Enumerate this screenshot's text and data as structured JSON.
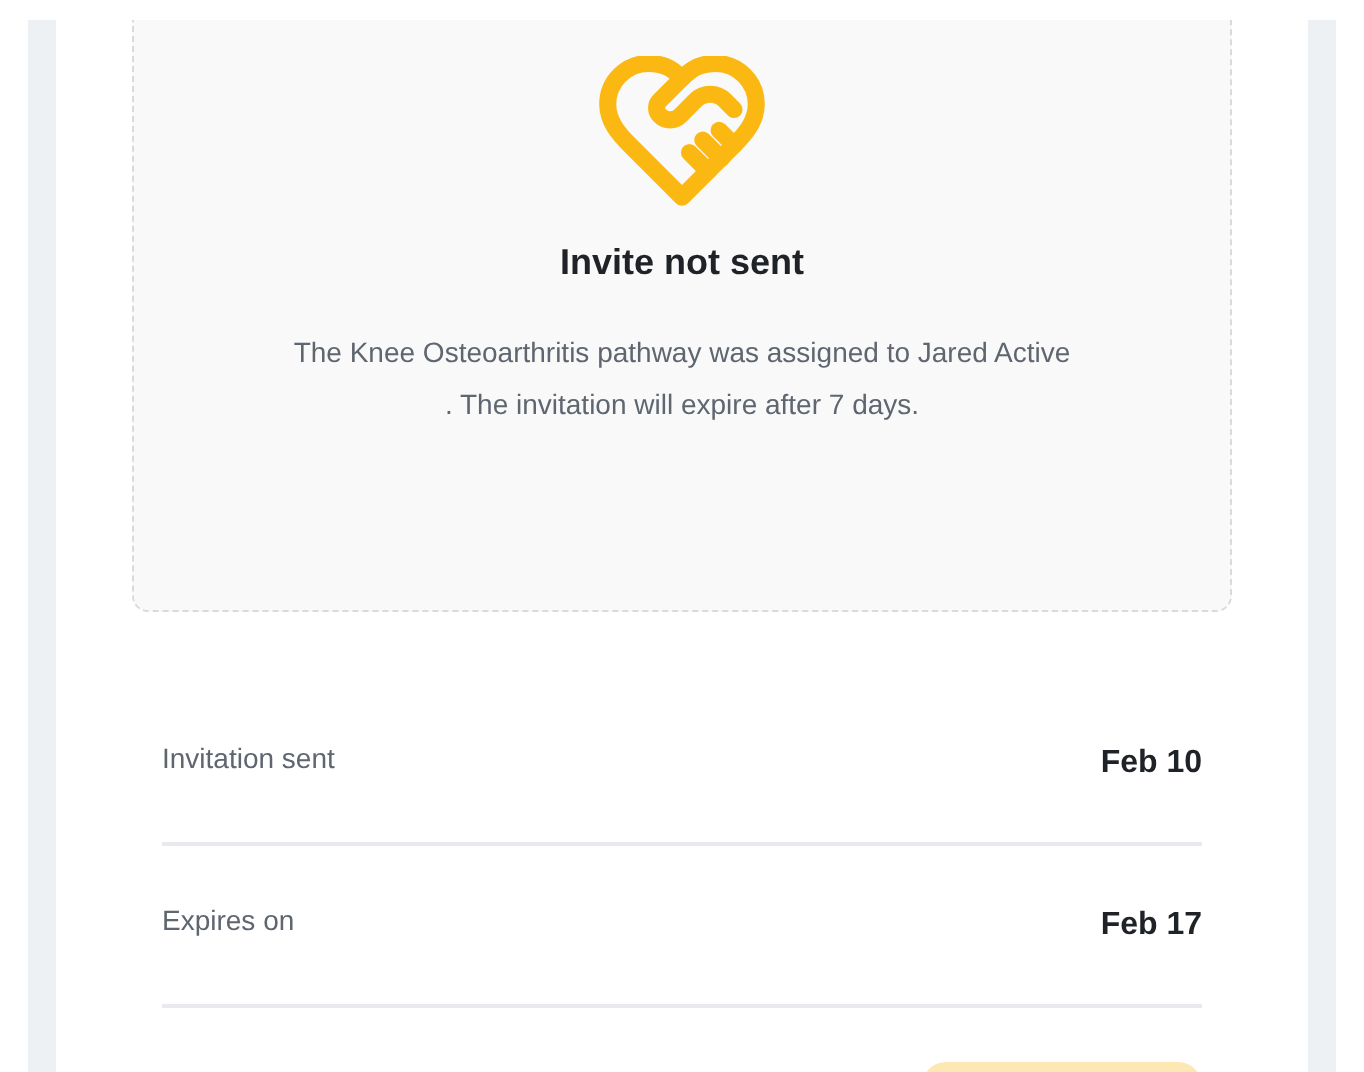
{
  "invite": {
    "title": "Invite not sent",
    "message": "The Knee Osteoarthritis pathway was assigned to Jared Active . The invitation will expire after 7 days."
  },
  "details": [
    {
      "label": "Invitation sent",
      "value": "Feb 10"
    },
    {
      "label": "Expires on",
      "value": "Feb 17"
    }
  ]
}
